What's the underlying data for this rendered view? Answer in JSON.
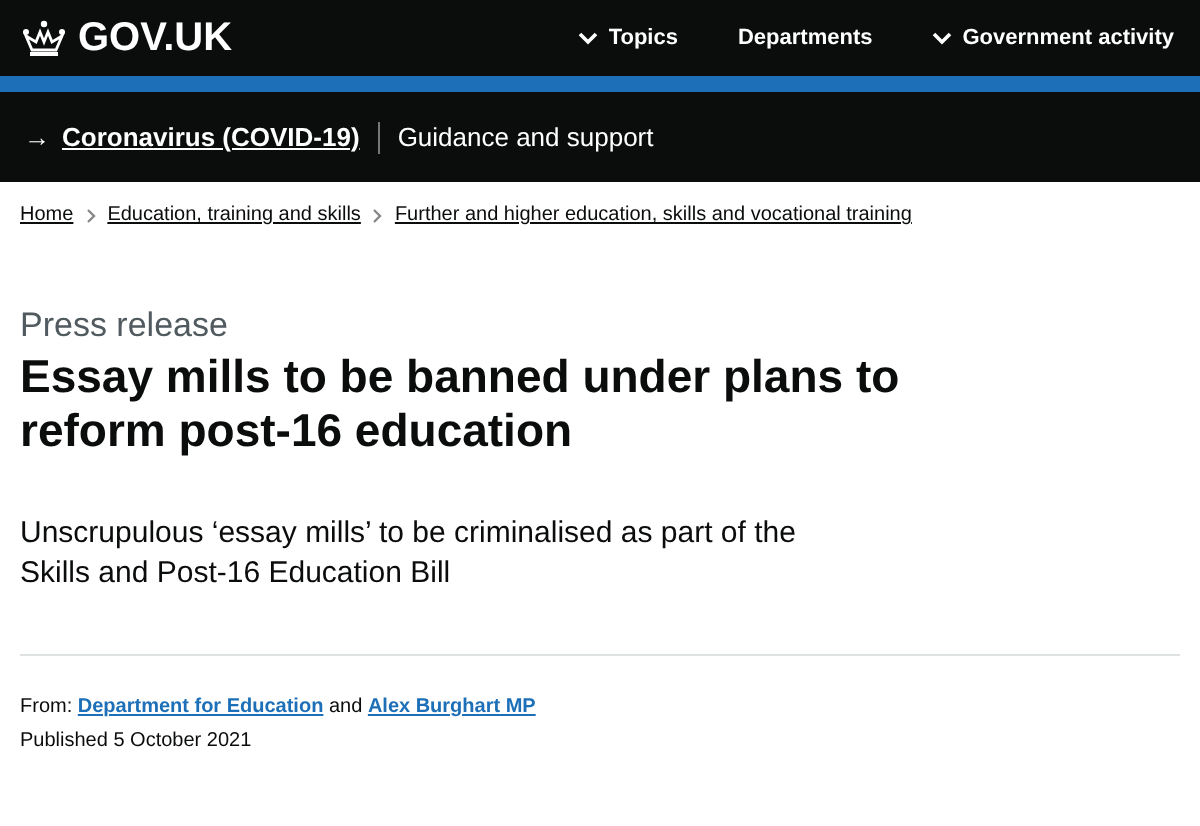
{
  "header": {
    "logo": "GOV.UK",
    "nav": [
      {
        "label": "Topics",
        "kind": "menu"
      },
      {
        "label": "Departments",
        "kind": "link"
      },
      {
        "label": "Government activity",
        "kind": "menu"
      }
    ]
  },
  "banner": {
    "arrow": "→",
    "link": "Coronavirus (COVID-19)",
    "text": "Guidance and support"
  },
  "breadcrumbs": [
    "Home",
    "Education, training and skills",
    "Further and higher education, skills and vocational training"
  ],
  "caption": "Press release",
  "title": "Essay mills to be banned under plans to reform post-16 education",
  "lead": "Unscrupulous ‘essay mills’ to be criminalised as part of the Skills and Post-16 Education Bill",
  "meta": {
    "from_label": "From:",
    "from": [
      "Department for Education",
      "Alex Burghart MP"
    ],
    "joiner": "and",
    "published_label": "Published",
    "published": "5 October 2021"
  }
}
